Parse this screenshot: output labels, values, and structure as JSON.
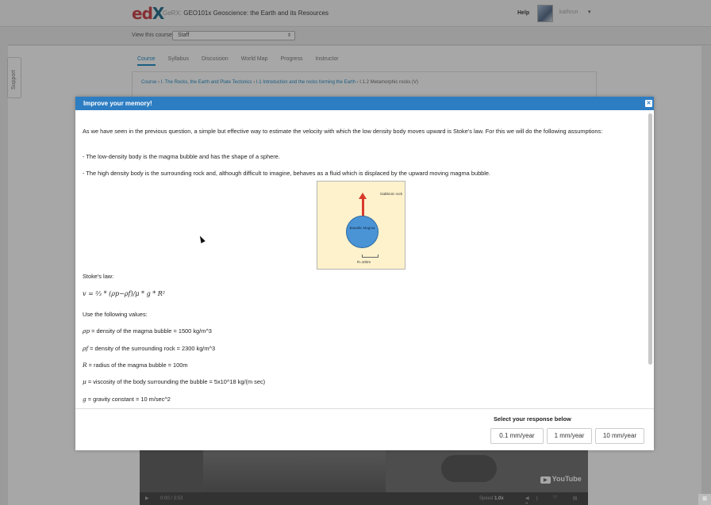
{
  "header": {
    "logo_e": "ed",
    "logo_x": "X",
    "course_org": "GeRX:",
    "course_title": "GEO101x Geoscience: the Earth and its Resources",
    "help": "Help",
    "username": "kathrun",
    "caret": "▾"
  },
  "staff_bar": {
    "label": "View this course as:",
    "selected": "Staff",
    "arrows": "⇕"
  },
  "support_tab": "Support",
  "course_nav": {
    "tabs": [
      "Course",
      "Syllabus",
      "Discussion",
      "World Map",
      "Progress",
      "Instructor"
    ],
    "active_index": 0
  },
  "breadcrumb": {
    "items": [
      "Course",
      "I. The Rocks, the Earth and Plate Tectonics",
      "I.1 Introduction and the rocks forming the Earth",
      "I.1.2 Metamorphic rocks (V)"
    ],
    "sep": "›"
  },
  "video": {
    "youtube": "YouTube",
    "play_badge": "▶",
    "play": "▶",
    "time": "0:00 / 3:53",
    "speed_label": "Speed",
    "speed_value": "1.0x",
    "controls": "◀) ⤧ ▤ ❝"
  },
  "corner_icon": "⊞",
  "modal": {
    "title": "Improve your memory!",
    "close": "✕",
    "intro": "As we have seen in the previous question, a simple but effective way to estimate the velocity with which the low density body moves upward is Stoke's law. For this we will do the following assumptions:",
    "assumption1": "- The low-density body is the magma bubble and has the shape of a sphere.",
    "assumption2": "- The high density body is the surrounding rock and, although difficult to imagine, behaves as a fluid which is displaced by the upward moving magma bubble.",
    "diagram": {
      "gabbroic": "Gabbroic rock",
      "magma": "Basaltic Magma",
      "radius": "R=100m"
    },
    "stokes_label": "Stoke's law:",
    "formula": "v = ⅔ * (ρp−ρf)/μ * g * R²",
    "values_label": "Use the following values:",
    "values": [
      {
        "sym": "ρp",
        "text": " = density of the magma bubble = 1500 kg/m^3"
      },
      {
        "sym": "ρf",
        "text": " = density of the surrounding rock = 2300 kg/m^3"
      },
      {
        "sym": "R",
        "text": " = radius of the magma bubble = 100m"
      },
      {
        "sym": "μ",
        "text": " = viscosity of the body surrounding the bubble = 5x10^18 kg/(m sec)"
      },
      {
        "sym": "g",
        "text": " = gravity constant = 10 m/sec^2"
      }
    ],
    "response_label": "Select your response below",
    "responses": [
      "0.1 mm/year",
      "1 mm/year",
      "10 mm/year"
    ]
  }
}
